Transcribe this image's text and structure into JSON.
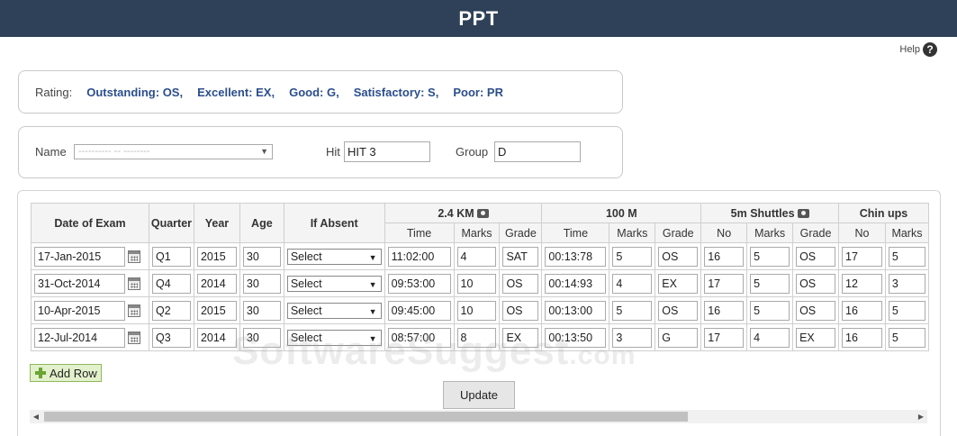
{
  "app": {
    "title": "PPT"
  },
  "help": {
    "label": "Help",
    "icon": "question-circle-icon"
  },
  "rating": {
    "label": "Rating:",
    "items": [
      "Outstanding: OS,",
      "Excellent: EX,",
      "Good: G,",
      "Satisfactory: S,",
      "Poor: PR"
    ]
  },
  "filters": {
    "name_label": "Name",
    "name_value": "---------- -- --------",
    "hit_label": "Hit",
    "hit_value": "HIT 3",
    "group_label": "Group",
    "group_value": "D"
  },
  "grid": {
    "headers": {
      "date": "Date of Exam",
      "quarter": "Quarter",
      "year": "Year",
      "age": "Age",
      "absent": "If Absent",
      "km": "2.4 KM",
      "m100": "100 M",
      "shuttles": "5m Shuttles",
      "chinups": "Chin ups"
    },
    "subheaders": {
      "time": "Time",
      "marks": "Marks",
      "grade": "Grade",
      "no": "No"
    },
    "rows": [
      {
        "date": "17-Jan-2015",
        "quarter": "Q1",
        "year": "2015",
        "age": "30",
        "absent": "Select",
        "km_time": "11:02:00",
        "km_marks": "4",
        "km_grade": "SAT",
        "m_time": "00:13:78",
        "m_marks": "5",
        "m_grade": "OS",
        "s_no": "16",
        "s_marks": "5",
        "s_grade": "OS",
        "c_no": "17",
        "c_marks": "5"
      },
      {
        "date": "31-Oct-2014",
        "quarter": "Q4",
        "year": "2014",
        "age": "30",
        "absent": "Select",
        "km_time": "09:53:00",
        "km_marks": "10",
        "km_grade": "OS",
        "m_time": "00:14:93",
        "m_marks": "4",
        "m_grade": "EX",
        "s_no": "17",
        "s_marks": "5",
        "s_grade": "OS",
        "c_no": "12",
        "c_marks": "3"
      },
      {
        "date": "10-Apr-2015",
        "quarter": "Q2",
        "year": "2015",
        "age": "30",
        "absent": "Select",
        "km_time": "09:45:00",
        "km_marks": "10",
        "km_grade": "OS",
        "m_time": "00:13:00",
        "m_marks": "5",
        "m_grade": "OS",
        "s_no": "16",
        "s_marks": "5",
        "s_grade": "OS",
        "c_no": "16",
        "c_marks": "5"
      },
      {
        "date": "12-Jul-2014",
        "quarter": "Q3",
        "year": "2014",
        "age": "30",
        "absent": "Select",
        "km_time": "08:57:00",
        "km_marks": "8",
        "km_grade": "EX",
        "m_time": "00:13:50",
        "m_marks": "3",
        "m_grade": "G",
        "s_no": "17",
        "s_marks": "4",
        "s_grade": "EX",
        "c_no": "16",
        "c_marks": "5"
      }
    ]
  },
  "actions": {
    "add_row": "Add Row",
    "update": "Update"
  },
  "watermark": {
    "main": "SoftwareSuggest",
    "suffix": ".com"
  },
  "colors": {
    "title_bar": "#2e4159",
    "rating_text": "#2b4e8c",
    "add_row_bg": "#e2f1cc"
  }
}
